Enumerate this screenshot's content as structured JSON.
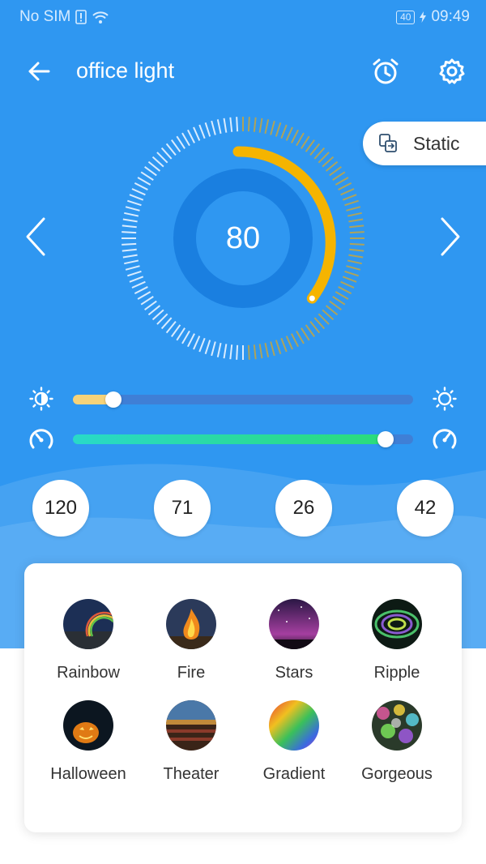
{
  "status_bar": {
    "carrier": "No SIM",
    "battery": "40",
    "time": "09:49"
  },
  "header": {
    "title": "office light"
  },
  "mode": {
    "label": "Static"
  },
  "dial": {
    "value": "80",
    "level": 0.8,
    "accent_color": "#f5b400"
  },
  "sliders": {
    "brightness": {
      "level": 0.12,
      "fill_color": "#f6d37a"
    },
    "speed": {
      "level": 0.92,
      "fill_color": "#29d9a5"
    }
  },
  "presets": [
    "120",
    "71",
    "26",
    "42"
  ],
  "scenes": [
    {
      "label": "Rainbow",
      "icon": "rainbow-thumbnail"
    },
    {
      "label": "Fire",
      "icon": "fire-thumbnail"
    },
    {
      "label": "Stars",
      "icon": "stars-thumbnail"
    },
    {
      "label": "Ripple",
      "icon": "ripple-thumbnail"
    },
    {
      "label": "Halloween",
      "icon": "halloween-thumbnail"
    },
    {
      "label": "Theater",
      "icon": "theater-thumbnail"
    },
    {
      "label": "Gradient",
      "icon": "gradient-thumbnail"
    },
    {
      "label": "Gorgeous",
      "icon": "gorgeous-thumbnail"
    }
  ],
  "colors": {
    "primary_blue": "#2f97f1",
    "dial_inner": "#1a7fe0"
  }
}
